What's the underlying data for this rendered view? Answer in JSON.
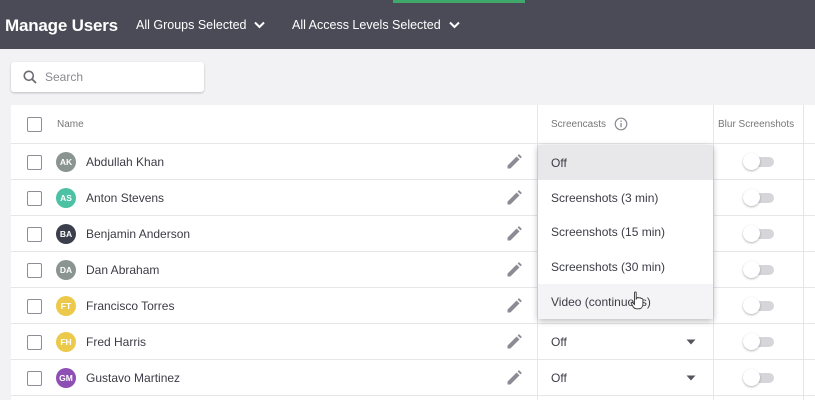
{
  "header": {
    "title": "Manage Users",
    "groups_filter": "All Groups Selected",
    "access_filter": "All Access Levels Selected"
  },
  "search": {
    "placeholder": "Search"
  },
  "table": {
    "columns": {
      "name": "Name",
      "screencasts": "Screencasts",
      "blur": "Blur Screenshots"
    },
    "rows": [
      {
        "initials": "AK",
        "name": "Abdullah Khan",
        "avatar_color": "#8a9490",
        "screencast": "Off"
      },
      {
        "initials": "AS",
        "name": "Anton Stevens",
        "avatar_color": "#4cc1a3",
        "screencast": "Off"
      },
      {
        "initials": "BA",
        "name": "Benjamin Anderson",
        "avatar_color": "#3a3f4b",
        "screencast": "Off"
      },
      {
        "initials": "DA",
        "name": "Dan Abraham",
        "avatar_color": "#8a9490",
        "screencast": "Off"
      },
      {
        "initials": "FT",
        "name": "Francisco Torres",
        "avatar_color": "#ecc94b",
        "screencast": "Off"
      },
      {
        "initials": "FH",
        "name": "Fred Harris",
        "avatar_color": "#ecc94b",
        "screencast": "Off"
      },
      {
        "initials": "GM",
        "name": "Gustavo Martinez",
        "avatar_color": "#8e4fb5",
        "screencast": "Off"
      }
    ]
  },
  "dropdown": {
    "options": [
      "Off",
      "Screenshots (3 min)",
      "Screenshots (15 min)",
      "Screenshots (30 min)",
      "Video (continuous)"
    ],
    "selected_index": 0,
    "hover_index": 4
  },
  "colors": {
    "header_bg": "#4b4b58",
    "accent": "#3fa86a"
  }
}
